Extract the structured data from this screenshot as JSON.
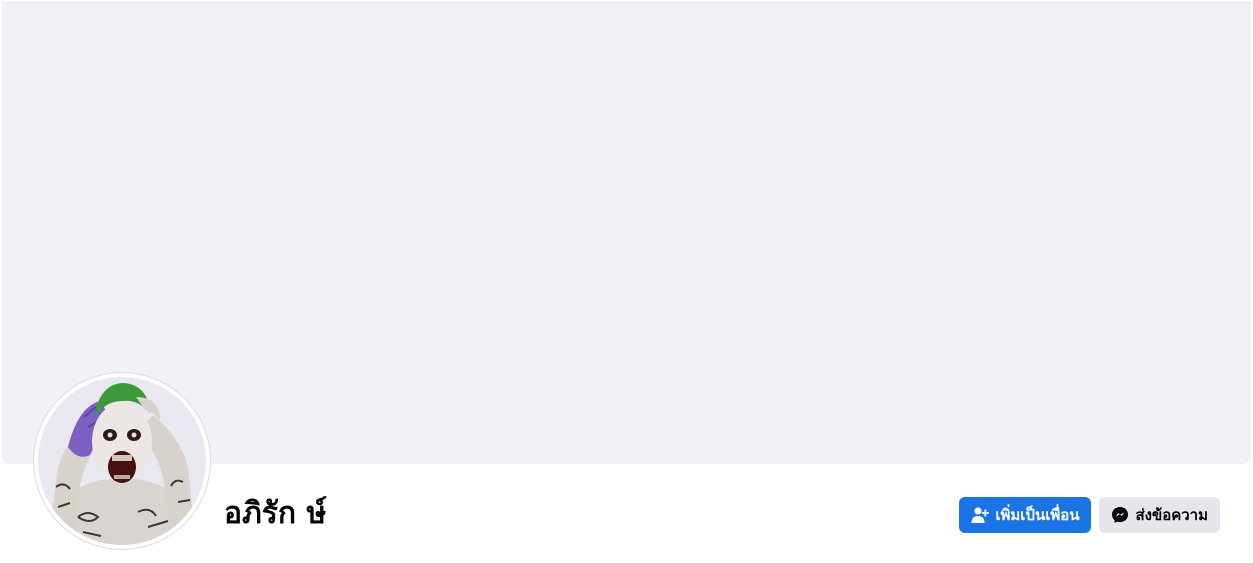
{
  "profile": {
    "name": "อภิรัก ษ์",
    "avatar_alt": "profile picture"
  },
  "actions": {
    "add_friend_label": "เพิ่มเป็นเพื่อน",
    "add_friend_icon": "user-plus-icon",
    "message_label": "ส่งข้อความ",
    "message_icon": "messenger-icon"
  },
  "colors": {
    "cover": "#f0f2f5",
    "primary": "#1b74e4",
    "secondary": "#e4e6eb"
  }
}
